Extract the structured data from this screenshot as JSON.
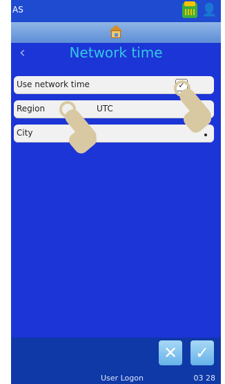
{
  "status": {
    "left_text": "AS"
  },
  "header": {
    "title": "Network time"
  },
  "rows": [
    {
      "label": "Use network time",
      "value": "",
      "checked": true
    },
    {
      "label": "Region",
      "value": "UTC"
    },
    {
      "label": "City",
      "value": ""
    }
  ],
  "footer": {
    "logon": "User Logon",
    "time": "03 28"
  },
  "icons": {
    "printer": "printer-status-icon",
    "user": "user-icon",
    "home": "home-icon",
    "back": "back-icon",
    "cancel": "cancel-icon",
    "ok": "check-icon"
  }
}
